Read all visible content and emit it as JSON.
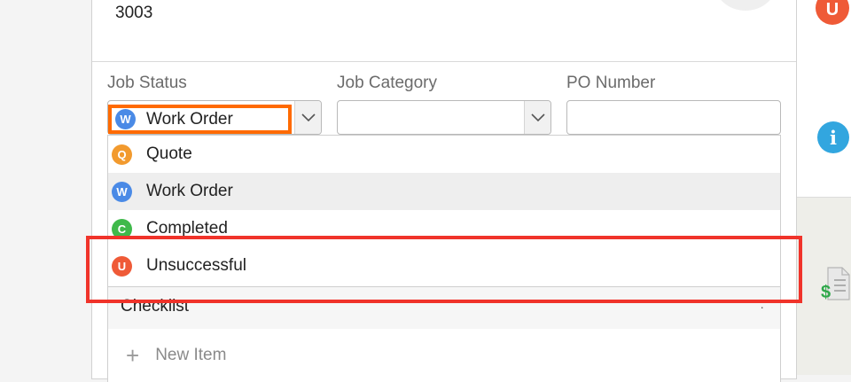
{
  "job": {
    "number": "3003"
  },
  "fields": {
    "job_status_label": "Job Status",
    "job_category_label": "Job Category",
    "po_number_label": "PO Number",
    "job_category_value": "",
    "po_number_value": ""
  },
  "status_select": {
    "badge": "W",
    "value": "Work Order",
    "badge_color": "#4a8ae6"
  },
  "status_options": [
    {
      "badge": "Q",
      "label": "Quote",
      "color": "#f29a2e"
    },
    {
      "badge": "W",
      "label": "Work Order",
      "color": "#4a8ae6"
    },
    {
      "badge": "C",
      "label": "Completed",
      "color": "#3fb94a"
    },
    {
      "badge": "U",
      "label": "Unsuccessful",
      "color": "#ef5a37"
    }
  ],
  "checklist": {
    "title": "Checklist",
    "new_item": "New Item"
  },
  "side": {
    "status_badge": "U",
    "info_glyph": "i"
  },
  "icons": {
    "dropdown_arrow": "chevron-down-icon",
    "more": "more-vertical-icon",
    "add": "plus-icon",
    "info": "info-icon",
    "invoice": "invoice-dollar-icon"
  },
  "colors": {
    "highlight_current": "#ff6a00",
    "highlight_target": "#f0332a"
  }
}
